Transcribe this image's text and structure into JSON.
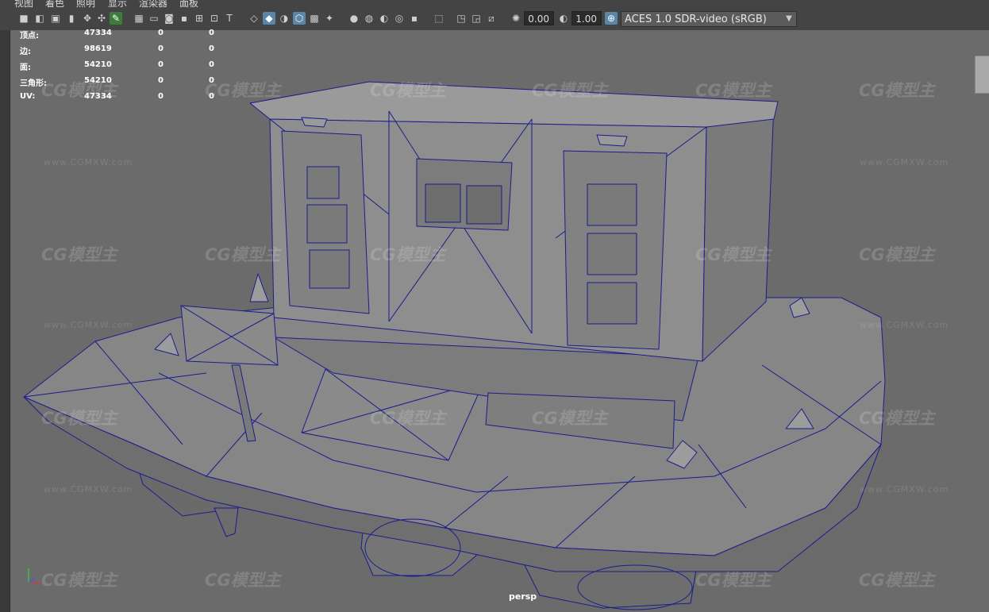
{
  "menu": [
    "视图",
    "着色",
    "照明",
    "显示",
    "渲染器",
    "面板"
  ],
  "toolbar": {
    "exposure_value": "0.00",
    "gamma_value": "1.00",
    "color_management": "ACES 1.0 SDR-video (sRGB)"
  },
  "hud": {
    "rows": [
      {
        "label": "顶点:",
        "values": [
          "47334",
          "0",
          "0"
        ]
      },
      {
        "label": "边:",
        "values": [
          "98619",
          "0",
          "0"
        ]
      },
      {
        "label": "面:",
        "values": [
          "54210",
          "0",
          "0"
        ]
      },
      {
        "label": "三角形:",
        "values": [
          "54210",
          "0",
          "0"
        ]
      },
      {
        "label": "UV:",
        "values": [
          "47334",
          "0",
          "0"
        ]
      }
    ]
  },
  "viewport": {
    "camera_label": "persp"
  },
  "watermark": {
    "brand": "CG模型主",
    "url": "www.CGMXW.com"
  },
  "colors": {
    "wireframe": "#1c1c8c",
    "viewport_bg": "#6b6b6b",
    "model_face": "#7a7a7a",
    "accent": "#5a86a8"
  }
}
